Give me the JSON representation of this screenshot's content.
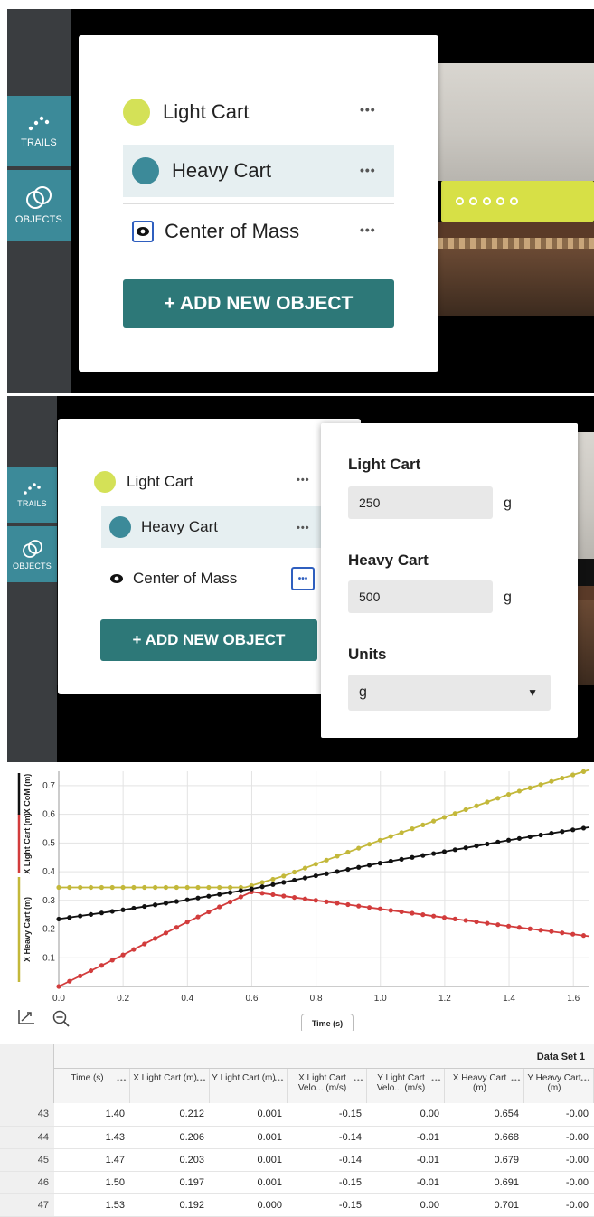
{
  "top_panel": {
    "sidebar": {
      "trails_label": "TRAILS",
      "objects_label": "OBJECTS"
    },
    "objects": [
      {
        "name": "Light Cart",
        "color": "#d4e157",
        "type": "dot"
      },
      {
        "name": "Heavy Cart",
        "color": "#3c8a99",
        "type": "dot",
        "selected": true
      },
      {
        "name": "Center of Mass",
        "type": "eye"
      }
    ],
    "more_label": "•••",
    "add_button": "+ ADD NEW OBJECT"
  },
  "mass_popup": {
    "light_label": "Light Cart",
    "light_value": "250",
    "heavy_label": "Heavy Cart",
    "heavy_value": "500",
    "unit_suffix": "g",
    "units_label": "Units",
    "units_value": "g"
  },
  "graph": {
    "xlabel": "Time (s)",
    "y_axis_labels": [
      {
        "text": "X Heavy Cart (m)",
        "color": "#c3b83a"
      },
      {
        "text": "X Light Cart (m)",
        "color": "#d23c3c"
      },
      {
        "text": "X CoM (m)",
        "color": "#111111"
      }
    ]
  },
  "chart_data": {
    "type": "line",
    "xlabel": "Time (s)",
    "xlim": [
      0,
      1.65
    ],
    "ylim": [
      0,
      0.75
    ],
    "x_ticks": [
      "0.0",
      "0.2",
      "0.4",
      "0.6",
      "0.8",
      "1.0",
      "1.2",
      "1.4",
      "1.6"
    ],
    "y_ticks": [
      "0.1",
      "0.2",
      "0.3",
      "0.4",
      "0.5",
      "0.6",
      "0.7"
    ],
    "grid": true,
    "series": [
      {
        "name": "X Heavy Cart (m)",
        "color": "#c3b83a",
        "points": [
          [
            0.0,
            0.345
          ],
          [
            0.58,
            0.345
          ],
          [
            0.7,
            0.385
          ],
          [
            1.0,
            0.51
          ],
          [
            1.2,
            0.59
          ],
          [
            1.4,
            0.67
          ],
          [
            1.65,
            0.755
          ]
        ]
      },
      {
        "name": "X Light Cart (m)",
        "color": "#d23c3c",
        "points": [
          [
            0.0,
            0.0
          ],
          [
            0.2,
            0.11
          ],
          [
            0.4,
            0.225
          ],
          [
            0.6,
            0.33
          ],
          [
            0.8,
            0.3
          ],
          [
            1.0,
            0.27
          ],
          [
            1.2,
            0.24
          ],
          [
            1.4,
            0.21
          ],
          [
            1.65,
            0.175
          ]
        ]
      },
      {
        "name": "X CoM (m)",
        "color": "#111111",
        "points": [
          [
            0.0,
            0.235
          ],
          [
            0.2,
            0.267
          ],
          [
            0.4,
            0.302
          ],
          [
            0.6,
            0.34
          ],
          [
            0.8,
            0.386
          ],
          [
            1.0,
            0.43
          ],
          [
            1.2,
            0.47
          ],
          [
            1.4,
            0.51
          ],
          [
            1.65,
            0.555
          ]
        ]
      }
    ]
  },
  "toolbar": {
    "autoscale_icon": "axes-icon",
    "zoom_icon": "zoom-out-icon"
  },
  "table": {
    "dataset_title": "Data Set 1",
    "columns": [
      "Time (s)",
      "X Light Cart (m)",
      "Y Light Cart (m)",
      "X Light Cart Velo... (m/s)",
      "Y Light Cart Velo... (m/s)",
      "X Heavy Cart (m)",
      "Y Heavy Cart (m)"
    ],
    "rows": [
      [
        "43",
        "1.40",
        "0.212",
        "0.001",
        "-0.15",
        "0.00",
        "0.654",
        "-0.00"
      ],
      [
        "44",
        "1.43",
        "0.206",
        "0.001",
        "-0.14",
        "-0.01",
        "0.668",
        "-0.00"
      ],
      [
        "45",
        "1.47",
        "0.203",
        "0.001",
        "-0.14",
        "-0.01",
        "0.679",
        "-0.00"
      ],
      [
        "46",
        "1.50",
        "0.197",
        "0.001",
        "-0.15",
        "-0.01",
        "0.691",
        "-0.00"
      ],
      [
        "47",
        "1.53",
        "0.192",
        "0.000",
        "-0.15",
        "0.00",
        "0.701",
        "-0.00"
      ]
    ]
  }
}
